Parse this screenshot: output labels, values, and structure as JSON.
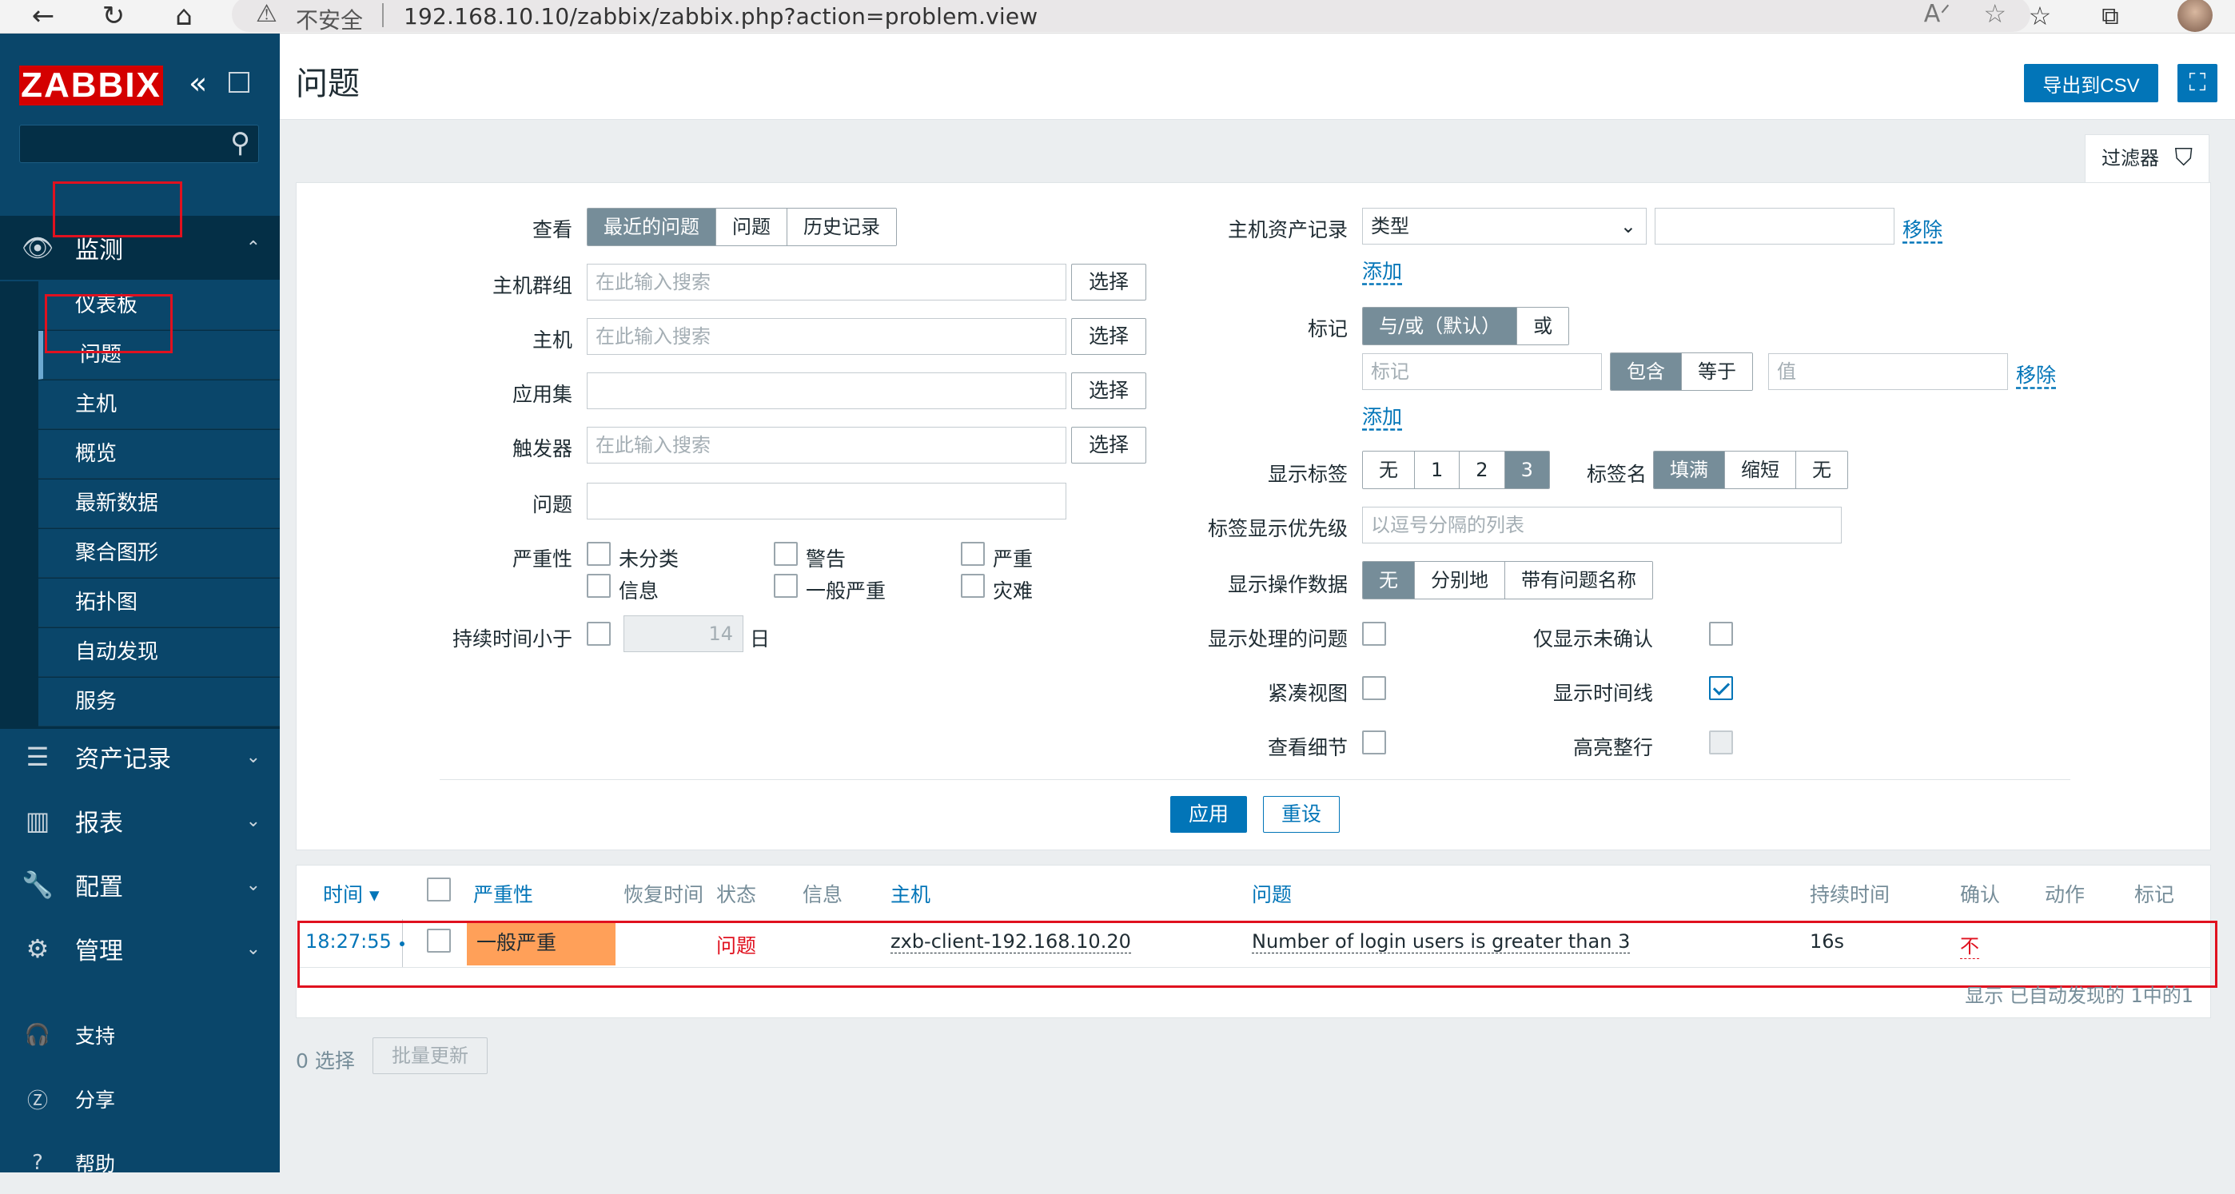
{
  "browser": {
    "insecure_label": "不安全",
    "url": "192.168.10.10/zabbix/zabbix.php?action=problem.view"
  },
  "sidebar": {
    "logo": "ZABBIX",
    "sections": {
      "monitoring": "监测",
      "inventory": "资产记录",
      "reports": "报表",
      "configuration": "配置",
      "administration": "管理",
      "support": "支持",
      "share": "分享",
      "help": "帮助"
    },
    "monitoring_items": [
      "仪表板",
      "问题",
      "主机",
      "概览",
      "最新数据",
      "聚合图形",
      "拓扑图",
      "自动发现",
      "服务"
    ],
    "active_item": "问题"
  },
  "header": {
    "title": "问题",
    "export_csv": "导出到CSV"
  },
  "filter": {
    "tab_label": "过滤器",
    "view_label": "查看",
    "view_options": [
      "最近的问题",
      "问题",
      "历史记录"
    ],
    "view_selected": "最近的问题",
    "hostgroup_label": "主机群组",
    "host_label": "主机",
    "application_label": "应用集",
    "trigger_label": "触发器",
    "problem_label": "问题",
    "search_placeholder": "在此输入搜索",
    "select_button": "选择",
    "severity_label": "严重性",
    "severities": [
      "未分类",
      "警告",
      "严重",
      "信息",
      "一般严重",
      "灾难"
    ],
    "age_label": "持续时间小于",
    "age_value": "14",
    "age_unit": "日",
    "inventory_label": "主机资产记录",
    "inventory_field": "类型",
    "remove": "移除",
    "add": "添加",
    "tags_label": "标记",
    "tags_operator_options": [
      "与/或（默认）",
      "或"
    ],
    "tag_placeholder": "标记",
    "tag_op_options": [
      "包含",
      "等于"
    ],
    "value_placeholder": "值",
    "show_tags_label": "显示标签",
    "show_tags_options": [
      "无",
      "1",
      "2",
      "3"
    ],
    "tag_name_label": "标签名",
    "tag_name_options": [
      "填满",
      "缩短",
      "无"
    ],
    "tag_priority_label": "标签显示优先级",
    "tag_priority_placeholder": "以逗号分隔的列表",
    "show_opdata_label": "显示操作数据",
    "opdata_options": [
      "无",
      "分别地",
      "带有问题名称"
    ],
    "show_suppressed_label": "显示处理的问题",
    "unack_only_label": "仅显示未确认",
    "compact_label": "紧凑视图",
    "timeline_label": "显示时间线",
    "details_label": "查看细节",
    "highlight_label": "高亮整行",
    "apply": "应用",
    "reset": "重设"
  },
  "table": {
    "headers": [
      "时间 ▾",
      "严重性",
      "恢复时间",
      "状态",
      "信息",
      "主机",
      "问题",
      "持续时间",
      "确认",
      "动作",
      "标记"
    ],
    "rows": [
      {
        "time": "18:27:55",
        "severity": "一般严重",
        "status": "问题",
        "host": "zxb-client-192.168.10.20",
        "problem": "Number of login users is greater than 3",
        "duration": "16s",
        "ack": "不"
      }
    ],
    "summary": "显示 已自动发现的 1中的1",
    "selected": "0 选择",
    "mass_update": "批量更新"
  },
  "colors": {
    "sidebar_bg": "#0a466a",
    "accent": "#0275b8",
    "severity_average": "#ffa059",
    "problem_red": "#e0111f"
  }
}
